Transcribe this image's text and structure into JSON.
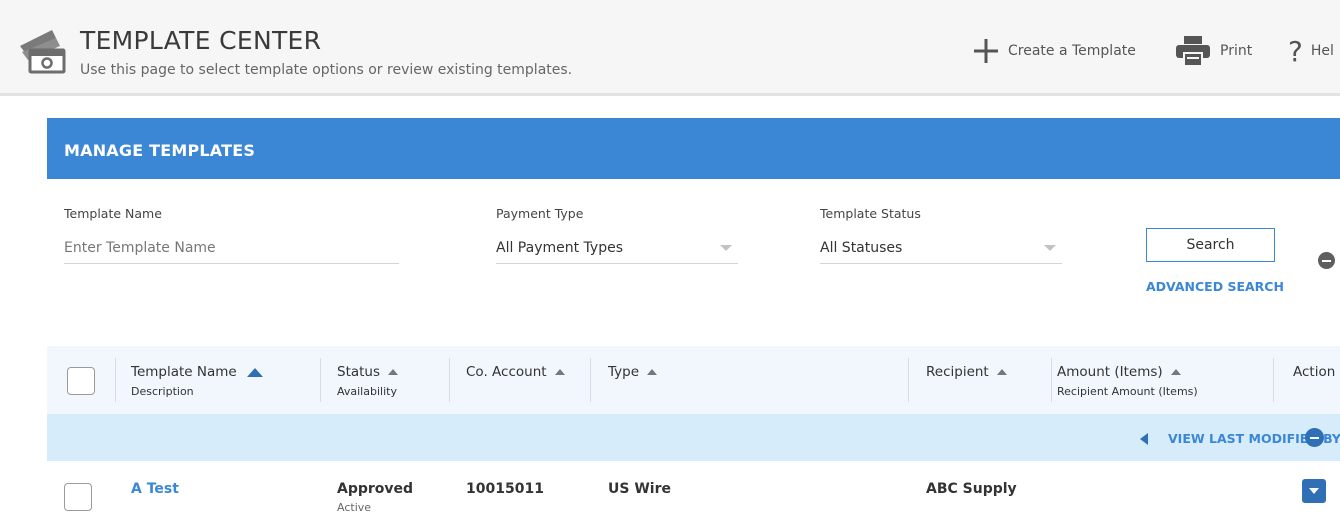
{
  "header": {
    "title": "TEMPLATE CENTER",
    "subtitle": "Use this page to select template options or review existing templates.",
    "icon": "template-cards-icon",
    "actions": {
      "create_label": "Create a Template",
      "print_label": "Print",
      "help_label": "Hel"
    }
  },
  "panel": {
    "title": "MANAGE TEMPLATES",
    "accent_color": "#3b87d6"
  },
  "filters": {
    "template_name": {
      "label": "Template Name",
      "placeholder": "Enter Template Name",
      "value": ""
    },
    "payment_type": {
      "label": "Payment Type",
      "value": "All Payment Types"
    },
    "template_status": {
      "label": "Template Status",
      "value": "All Statuses"
    },
    "search_label": "Search",
    "advanced_search_label": "ADVANCED SEARCH"
  },
  "table": {
    "columns": [
      {
        "title": "Template Name",
        "subtitle": "Description",
        "sorted": true
      },
      {
        "title": "Status",
        "subtitle": "Availability"
      },
      {
        "title": "Co. Account",
        "subtitle": ""
      },
      {
        "title": "Type",
        "subtitle": ""
      },
      {
        "title": "Recipient",
        "subtitle": ""
      },
      {
        "title": "Amount (Items)",
        "subtitle": "Recipient Amount (Items)"
      },
      {
        "title": "Action",
        "subtitle": ""
      }
    ],
    "view_last_modified_label": "VIEW LAST MODIFIED BY",
    "rows": [
      {
        "name": "A Test",
        "status": "Approved",
        "availability": "Active",
        "co_account": "10015011",
        "type": "US Wire",
        "recipient": "ABC Supply"
      }
    ]
  }
}
